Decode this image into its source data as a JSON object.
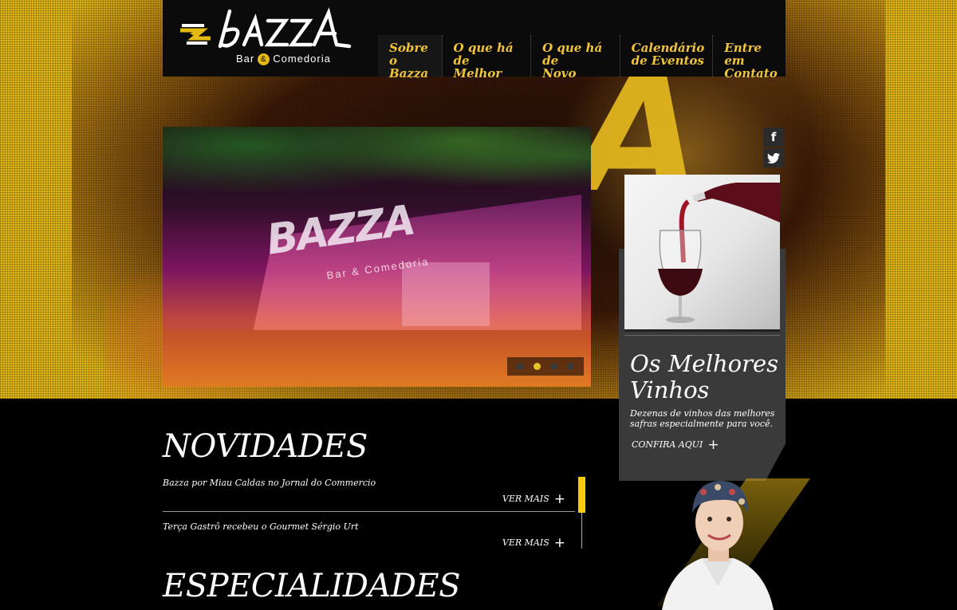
{
  "brand": {
    "name": "BAZZA",
    "subtitle_left": "Bar",
    "subtitle_amp": "&",
    "subtitle_right": "Comedoria"
  },
  "nav": [
    {
      "line1": "Sobre",
      "line2": "o Bazza"
    },
    {
      "line1": "O que há de",
      "line2": "Melhor"
    },
    {
      "line1": "O que há de",
      "line2": "Novo"
    },
    {
      "line1": "Calendário",
      "line2": "de Eventos"
    },
    {
      "line1": "Entre em",
      "line2": "Contato"
    }
  ],
  "slider": {
    "image_logo": "BAZZA",
    "image_logo_sub": "Bar & Comedoria",
    "slide_count": 4,
    "active_index": 1
  },
  "social": {
    "facebook_glyph": "f",
    "twitter_glyph": "t"
  },
  "promo": {
    "title": "Os Melhores Vinhos",
    "description": "Dezenas de vinhos das melhores safras especialmente para você.",
    "link_label": "CONFIRA AQUI",
    "link_icon": "+"
  },
  "sections": {
    "novidades": "NOVIDADES",
    "especialidades": "ESPECIALIDADES"
  },
  "news": [
    {
      "title": "Bazza por Miau Caldas no Jornal do Commercio",
      "more": "VER MAIS",
      "icon": "+"
    },
    {
      "title": "Terça Gastrô recebeu o Gourmet Sérgio Urt",
      "more": "VER MAIS",
      "icon": "+"
    }
  ],
  "colors": {
    "accent": "#f2cd12",
    "nav_text": "#f1c53a",
    "background": "#000000",
    "card": "#3a3a3a"
  }
}
